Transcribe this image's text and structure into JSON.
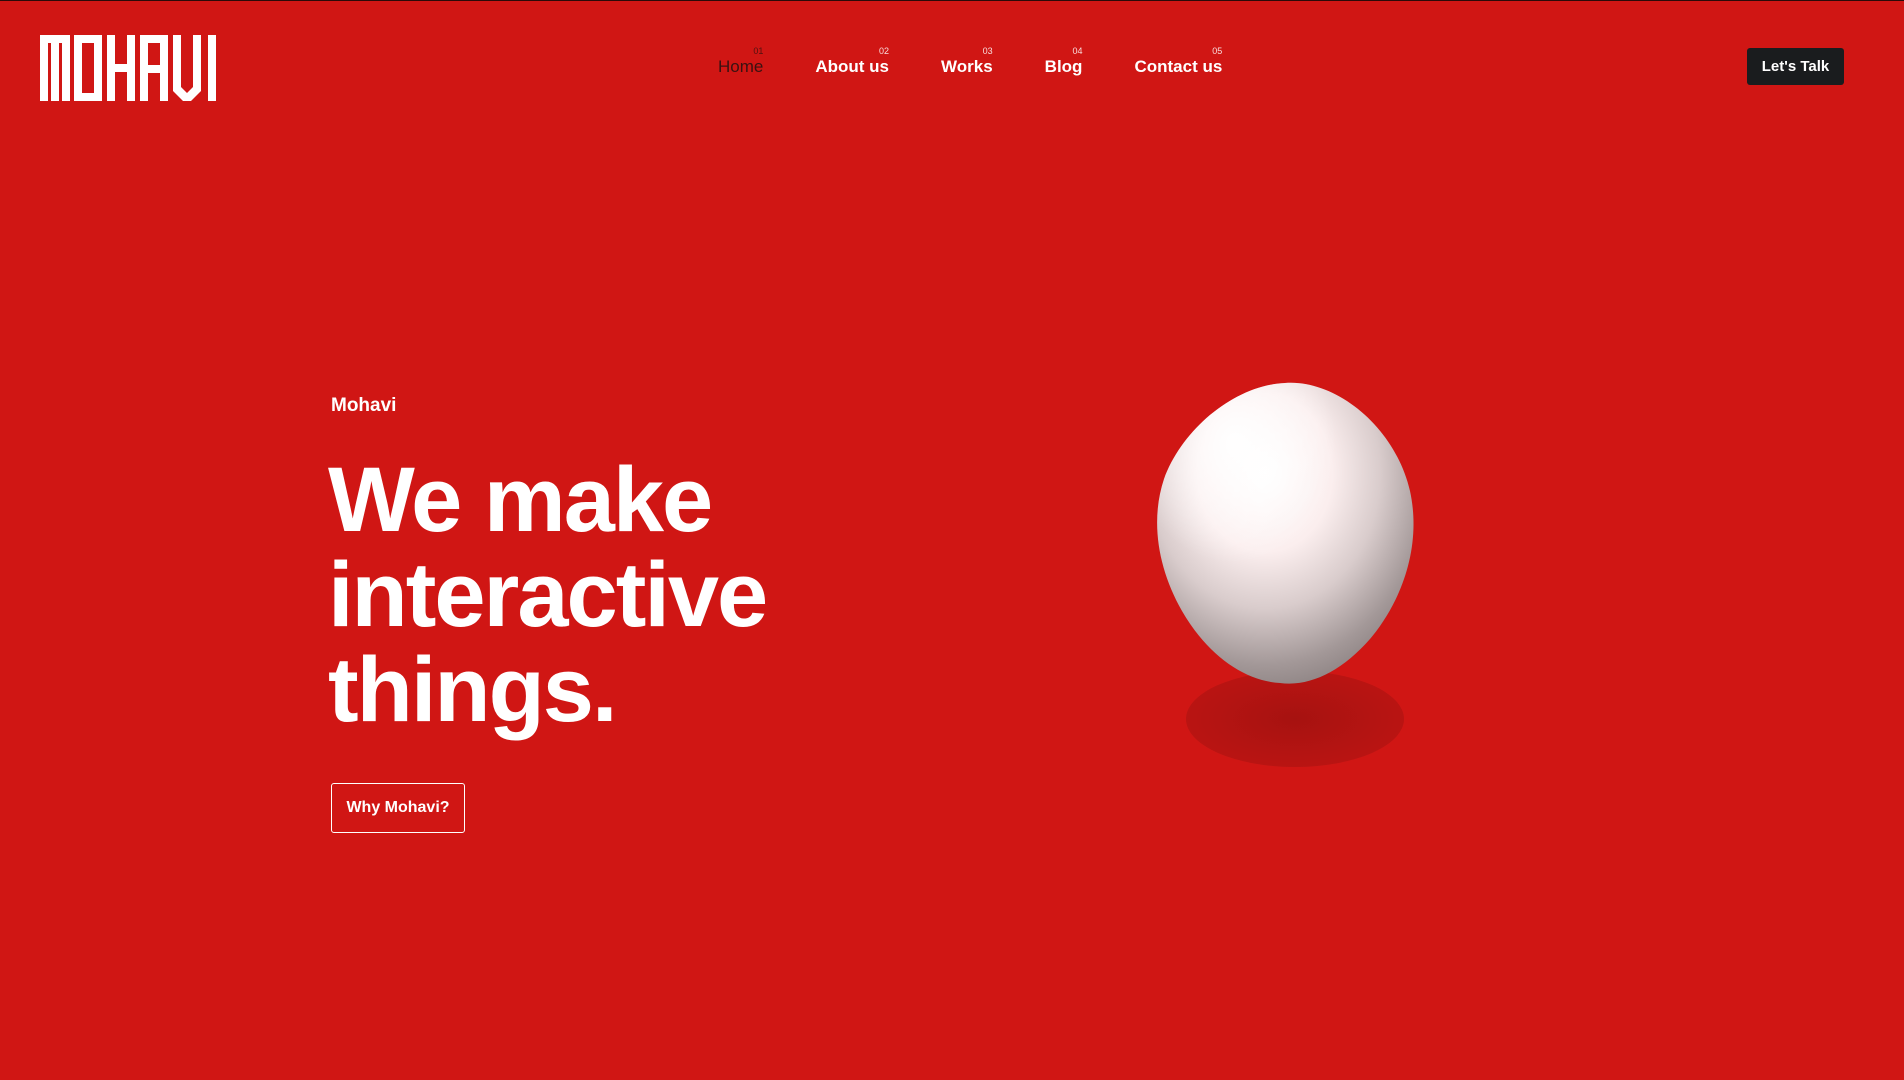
{
  "brand": {
    "logo_text": "MOHAVI",
    "accent_color": "#d01614",
    "dark_color": "#1a1c1e"
  },
  "nav": {
    "items": [
      {
        "num": "01",
        "label": "Home",
        "active": true
      },
      {
        "num": "02",
        "label": "About us",
        "active": false
      },
      {
        "num": "03",
        "label": "Works",
        "active": false
      },
      {
        "num": "04",
        "label": "Blog",
        "active": false
      },
      {
        "num": "05",
        "label": "Contact us",
        "active": false
      }
    ]
  },
  "header": {
    "cta_label": "Let's Talk"
  },
  "hero": {
    "eyebrow": "Mohavi",
    "headline_lines": [
      "We make",
      "interactive",
      "things."
    ],
    "button_label": "Why Mohavi?"
  }
}
